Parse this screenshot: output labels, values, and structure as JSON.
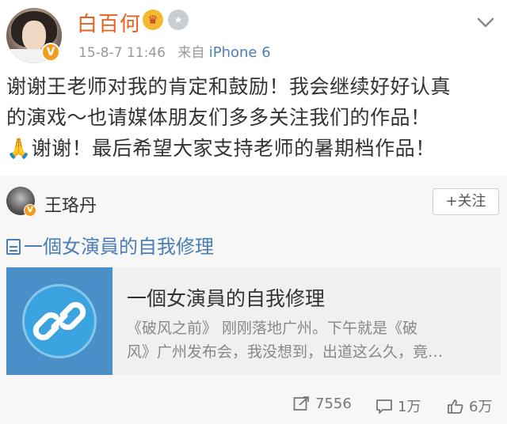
{
  "post": {
    "username": "白百何",
    "verified_badge": "V",
    "crown_icon": "crown-icon",
    "medal_icon": "medal-icon",
    "date": "15-8-7 11:46",
    "source_prefix": "来自",
    "source": "iPhone 6",
    "text_lines": [
      "谢谢王老师对我的肯定和鼓励！我会继续好好认真",
      "的演戏～也请媒体朋友们多多关注我们的作品！",
      "🙏谢谢！最后希望大家支持老师的暑期档作品！"
    ]
  },
  "repost": {
    "author": "王珞丹",
    "verified_badge": "V",
    "follow_label": "+关注",
    "article_link": "一個女演員的自我修理",
    "card": {
      "title": "一個女演員的自我修理",
      "desc_lines": [
        "《破风之前》 刚刚落地广州。下午就是《破",
        "风》广州发布会，我没想到，出道这么久，竟…"
      ]
    }
  },
  "actions": {
    "repost_count": "7556",
    "comment_count": "1万",
    "like_count": "6万"
  },
  "colors": {
    "username": "#e8611e",
    "link": "#4a7eb5",
    "badge": "#f39c1d"
  }
}
